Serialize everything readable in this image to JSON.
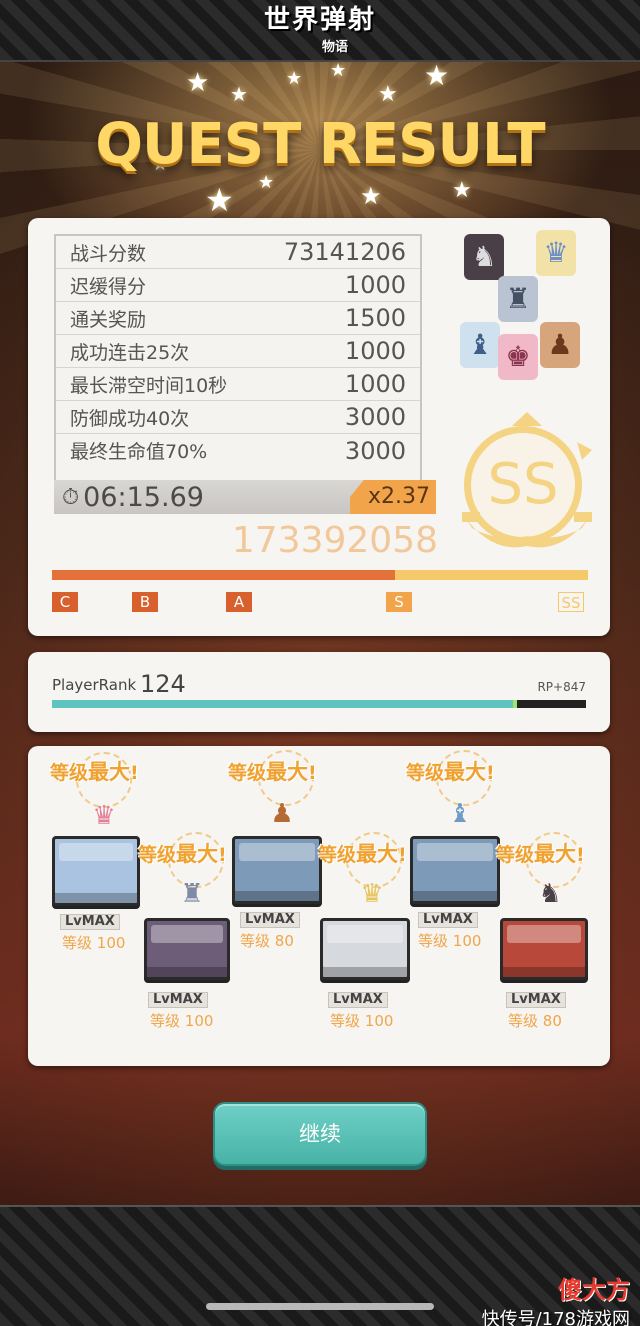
{
  "logo": {
    "line1": "世界弹射",
    "line2": "物语"
  },
  "title": "QUEST RESULT",
  "score_rows": [
    {
      "label": "战斗分数",
      "value": "73141206"
    },
    {
      "label": "迟缓得分",
      "value": "1000"
    },
    {
      "label": "通关奖励",
      "value": "1500"
    },
    {
      "label": "成功连击25次",
      "value": "1000"
    },
    {
      "label": "最长滞空时间10秒",
      "value": "1000"
    },
    {
      "label": "防御成功40次",
      "value": "3000"
    },
    {
      "label": "最终生命值70%",
      "value": "3000"
    }
  ],
  "timer": {
    "icon": "stopwatch-icon",
    "value": "06:15.69",
    "multiplier": "x2.37"
  },
  "total_score": "173392058",
  "rank": "SS",
  "rank_gauge": {
    "marks": [
      "C",
      "B",
      "A",
      "S",
      "SS"
    ],
    "fill_fraction": 0.64,
    "colors": {
      "filled": "#e5713a",
      "unfilled": "#f5c86a",
      "marker_dark": "#d8602d",
      "marker_light": "#f2a44a"
    }
  },
  "player": {
    "rank_label": "PlayerRank",
    "rank_value": "124",
    "rp": "RP+847",
    "exp_fraction": 0.87
  },
  "characters": [
    {
      "banner": "等级",
      "banner_big": "最大",
      "banner_end": "!",
      "lvmax": "LvMAX",
      "level_label": "等级",
      "level": "100"
    },
    {
      "banner": "等级",
      "banner_big": "最大",
      "banner_end": "!",
      "lvmax": "LvMAX",
      "level_label": "等级",
      "level": "100"
    },
    {
      "banner": "等级",
      "banner_big": "最大",
      "banner_end": "!",
      "lvmax": "LvMAX",
      "level_label": "等级",
      "level": "80"
    },
    {
      "banner": "等级",
      "banner_big": "最大",
      "banner_end": "!",
      "lvmax": "LvMAX",
      "level_label": "等级",
      "level": "100"
    },
    {
      "banner": "等级",
      "banner_big": "最大",
      "banner_end": "!",
      "lvmax": "LvMAX",
      "level_label": "等级",
      "level": "100"
    },
    {
      "banner": "等级",
      "banner_big": "最大",
      "banner_end": "!",
      "lvmax": "LvMAX",
      "level_label": "等级",
      "level": "80"
    }
  ],
  "continue_label": "继续",
  "watermark": {
    "top": "傻大方",
    "bottom": "快传号/178游戏网"
  }
}
